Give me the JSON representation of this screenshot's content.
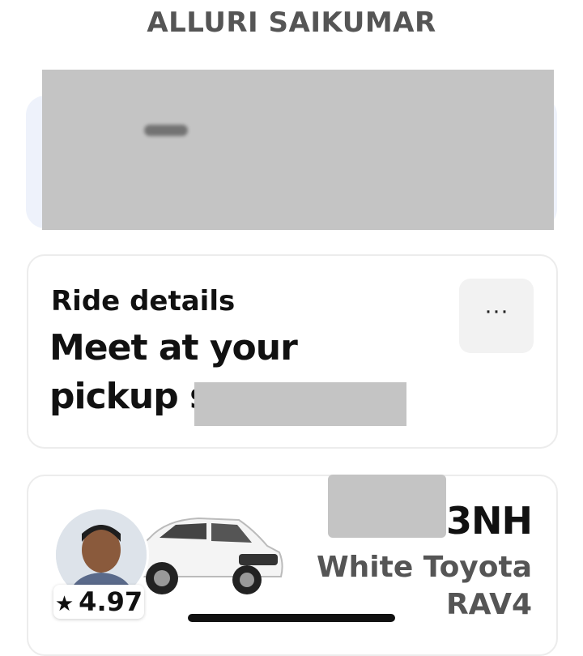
{
  "header": {
    "title": "ALLURI SAIKUMAR"
  },
  "ride": {
    "label": "Ride details",
    "message": "Meet at your pickup spot on",
    "more_icon": "ellipsis-icon",
    "more_glyph": "···"
  },
  "driver": {
    "rating_star": "★",
    "rating": "4.97",
    "plate": "33NH",
    "vehicle": "White Toyota RAV4"
  },
  "colors": {
    "redaction": "#c4c4c4",
    "card_border": "#ececec",
    "secondary_text": "#555555"
  }
}
